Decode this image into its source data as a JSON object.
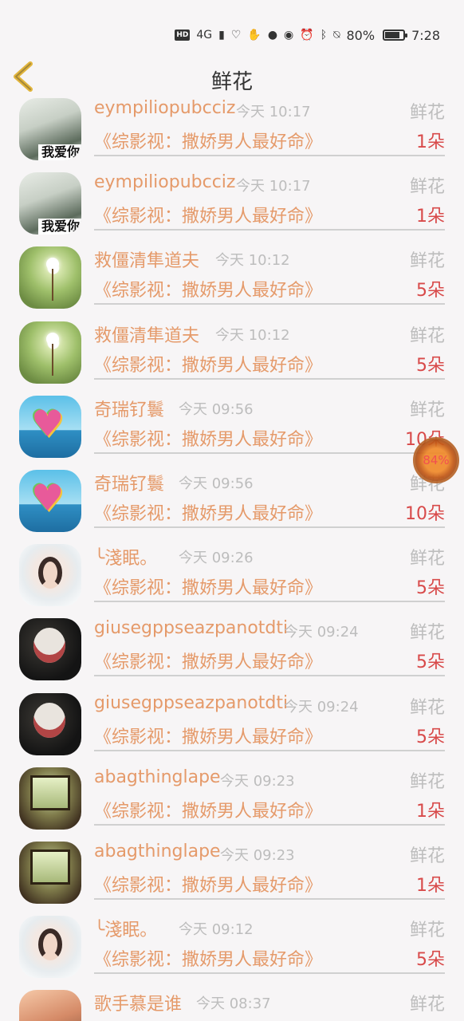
{
  "status_bar": {
    "hd": "HD",
    "network": "4G",
    "battery_percent": "80%",
    "battery_level": 0.8,
    "time": "7:28"
  },
  "header": {
    "back_icon": "chevron-left-icon",
    "title": "鲜花",
    "accent": "#e2b53c"
  },
  "floating_widget": {
    "label": "84%"
  },
  "colors": {
    "name": "#e59a6a",
    "time": "#bdbdbd",
    "count": "#d84a4a"
  },
  "list": {
    "items": [
      {
        "name": "eympiliopubcciz",
        "time": "今天 10:17",
        "gift": "鲜花",
        "program": "《综影视：撒娇男人最好命》",
        "count": "1朵",
        "avatar_text": "我爱你"
      },
      {
        "name": "eympiliopubcciz",
        "time": "今天 10:17",
        "gift": "鲜花",
        "program": "《综影视：撒娇男人最好命》",
        "count": "1朵",
        "avatar_text": "我爱你"
      },
      {
        "name": "救僵清隼道夫",
        "time": "今天 10:12",
        "gift": "鲜花",
        "program": "《综影视：撒娇男人最好命》",
        "count": "5朵"
      },
      {
        "name": "救僵清隼道夫",
        "time": "今天 10:12",
        "gift": "鲜花",
        "program": "《综影视：撒娇男人最好命》",
        "count": "5朵"
      },
      {
        "name": "奇瑞钌鬟",
        "time": "今天 09:56",
        "gift": "鲜花",
        "program": "《综影视：撒娇男人最好命》",
        "count": "10朵"
      },
      {
        "name": "奇瑞钌鬟",
        "time": "今天 09:56",
        "gift": "鲜花",
        "program": "《综影视：撒娇男人最好命》",
        "count": "10朵"
      },
      {
        "name": "╰淺眠。",
        "time": "今天 09:26",
        "gift": "鲜花",
        "program": "《综影视：撒娇男人最好命》",
        "count": "5朵"
      },
      {
        "name": "giusegppseazpanotdti",
        "time": "今天 09:24",
        "gift": "鲜花",
        "program": "《综影视：撒娇男人最好命》",
        "count": "5朵"
      },
      {
        "name": "giusegppseazpanotdti",
        "time": "今天 09:24",
        "gift": "鲜花",
        "program": "《综影视：撒娇男人最好命》",
        "count": "5朵"
      },
      {
        "name": "abagthinglape",
        "time": "今天 09:23",
        "gift": "鲜花",
        "program": "《综影视：撒娇男人最好命》",
        "count": "1朵"
      },
      {
        "name": "abagthinglape",
        "time": "今天 09:23",
        "gift": "鲜花",
        "program": "《综影视：撒娇男人最好命》",
        "count": "1朵"
      },
      {
        "name": "╰淺眠。",
        "time": "今天 09:12",
        "gift": "鲜花",
        "program": "《综影视：撒娇男人最好命》",
        "count": "5朵"
      },
      {
        "name": "歌手慕是谁",
        "time": "今天 08:37",
        "gift": "鲜花",
        "program": "",
        "count": ""
      }
    ]
  }
}
